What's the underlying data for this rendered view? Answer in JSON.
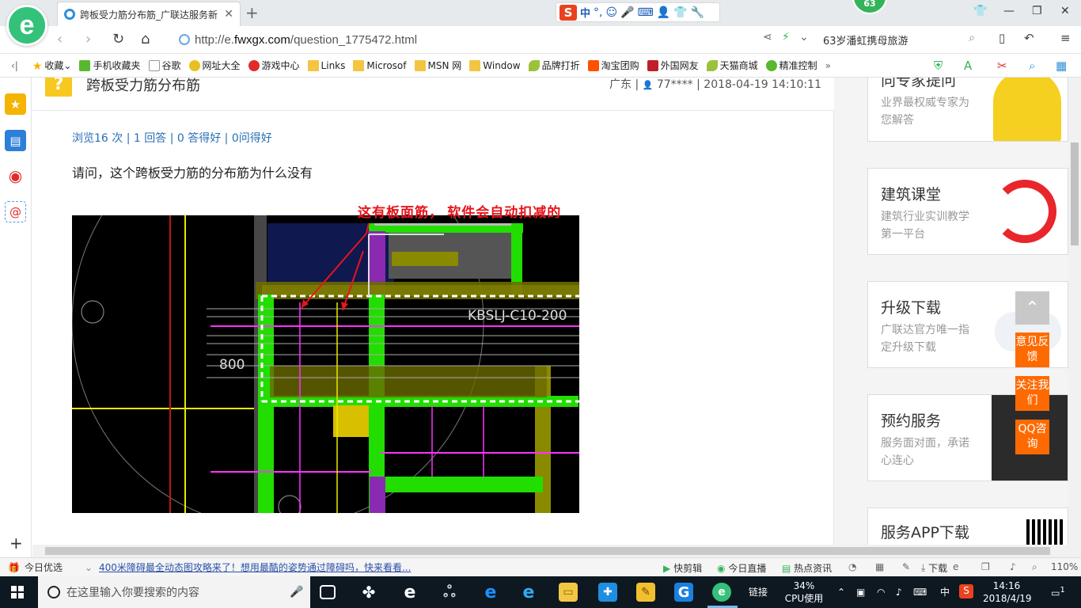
{
  "browser": {
    "tab_title": "跨板受力筋分布筋_广联达服务新",
    "url_prefix": "http://e.",
    "url_domain": "fwxgx.com",
    "url_path": "/question_1775472.html",
    "search_text": "63岁潘虹携母旅游",
    "badge_count": "63",
    "ime_label": "中",
    "ime_punct": "°,"
  },
  "bookmarks": [
    {
      "label": "收藏",
      "icon": "star-icon"
    },
    {
      "label": "手机收藏夹",
      "icon": "phone-icon"
    },
    {
      "label": "谷歌",
      "icon": "page-icon"
    },
    {
      "label": "网址大全",
      "icon": "globe-icon"
    },
    {
      "label": "游戏中心",
      "icon": "game-icon"
    },
    {
      "label": "Links",
      "icon": "folder-icon"
    },
    {
      "label": "Microsof",
      "icon": "folder-icon"
    },
    {
      "label": "MSN 网",
      "icon": "folder-icon"
    },
    {
      "label": "Window",
      "icon": "folder-icon"
    },
    {
      "label": "品牌打折",
      "icon": "leaf-icon"
    },
    {
      "label": "淘宝团购",
      "icon": "taobao-icon"
    },
    {
      "label": "外国网友",
      "icon": "flag-icon"
    },
    {
      "label": "天猫商城",
      "icon": "leaf-icon"
    },
    {
      "label": "精准控制",
      "icon": "wechat-icon"
    }
  ],
  "question": {
    "title": "跨板受力筋分布筋",
    "region": "广东",
    "user": "77****",
    "datetime": "2018-04-19 14:10:11",
    "stats": "浏览16 次 | 1 回答 | 0 答得好 | 0问得好",
    "body": "请问，这个跨板受力筋的分布筋为什么没有",
    "annotation": "这有板面筋， 软件会自动扣减的",
    "cad_label_1": "KBSLJ-C10-200",
    "cad_label_2": "800"
  },
  "ads": [
    {
      "title": "向专家提问",
      "desc": "业界最权威专家为您解答"
    },
    {
      "title": "建筑课堂",
      "desc": "建筑行业实训教学第一平台"
    },
    {
      "title": "升级下载",
      "desc": "广联达官方唯一指定升级下载"
    },
    {
      "title": "预约服务",
      "desc": "服务面对面，承诺心连心"
    },
    {
      "title": "服务APP下载",
      "desc": ""
    }
  ],
  "float_buttons": [
    "意见反馈",
    "关注我们",
    "QQ咨询"
  ],
  "statusbar": {
    "today": "今日优选",
    "news": "400米障碍最全动态图攻略来了！想用最酷的姿势通过障碍吗，快来看看...",
    "clip": "快剪辑",
    "live": "今日直播",
    "hot": "热点资讯",
    "download": "下载",
    "zoom": "110%"
  },
  "taskbar": {
    "search_placeholder": "在这里输入你要搜索的内容",
    "link_label": "链接",
    "cpu_percent": "34%",
    "cpu_label": "CPU使用",
    "ime": "中",
    "time": "14:16",
    "date": "2018/4/19",
    "notifications": "1"
  },
  "colors": {
    "brand_green": "#34c27a",
    "link_blue": "#2a6fb5",
    "annotation_red": "#e8141c",
    "float_orange": "#ff6a00",
    "question_yellow": "#f7c81e"
  }
}
